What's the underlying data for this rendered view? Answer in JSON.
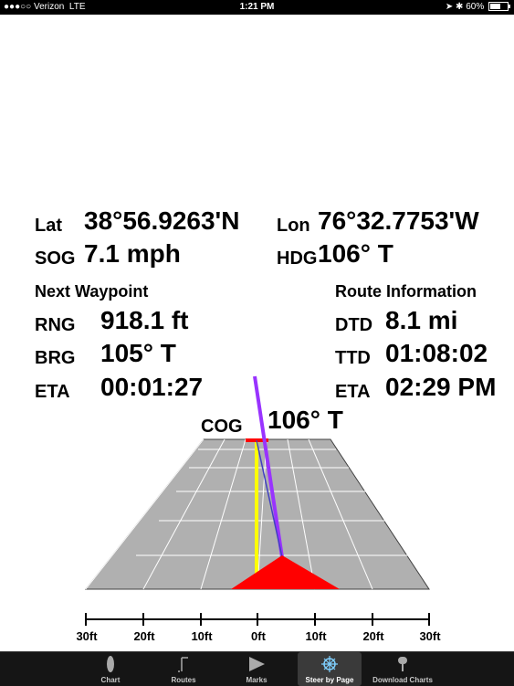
{
  "status_bar": {
    "signal": "●●●○○",
    "carrier": "Verizon",
    "network": "LTE",
    "time": "1:21 PM",
    "icons": "➤ ✱",
    "battery": "60%",
    "battery_level": 0.6
  },
  "position": {
    "lat_label": "Lat",
    "lat_value": "38°56.9263'N",
    "lon_label": "Lon",
    "lon_value": "76°32.7753'W",
    "sog_label": "SOG",
    "sog_value": "7.1 mph",
    "hdg_label": "HDG",
    "hdg_value": "106° T"
  },
  "next_waypoint": {
    "title": "Next Waypoint",
    "rng_label": "RNG",
    "rng_value": "918.1 ft",
    "brg_label": "BRG",
    "brg_value": "105° T",
    "eta_label": "ETA",
    "eta_value": "00:01:27"
  },
  "route_info": {
    "title": "Route Information",
    "dtd_label": "DTD",
    "dtd_value": "8.1 mi",
    "ttd_label": "TTD",
    "ttd_value": "01:08:02",
    "eta_label": "ETA",
    "eta_value": "02:29 PM"
  },
  "cog": {
    "label": "COG",
    "value": "106° T"
  },
  "scale": {
    "ticks": [
      "30ft",
      "20ft",
      "10ft",
      "0ft",
      "10ft",
      "20ft",
      "30ft"
    ]
  },
  "colors": {
    "highway": "#b0b0b0",
    "course_line": "#ffff00",
    "cog_line": "#9933ff",
    "boat": "#ff0000",
    "tabbar": "#151515"
  },
  "tabs": [
    {
      "label": "Chart",
      "icon": "boat-icon"
    },
    {
      "label": "Routes",
      "icon": "route-flag-icon"
    },
    {
      "label": "Marks",
      "icon": "mark-icon"
    },
    {
      "label": "Steer by Page",
      "icon": "helm-wheel-icon",
      "active": true
    },
    {
      "label": "Download Charts",
      "icon": "download-icon"
    }
  ]
}
